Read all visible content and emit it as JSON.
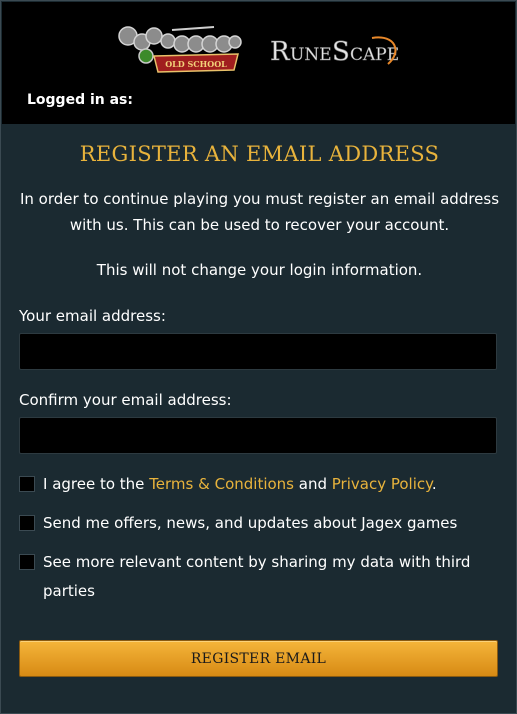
{
  "header": {
    "osrs_logo_text": "RuneScape Old School",
    "rs_logo_text": "RuneScape",
    "logged_in_label": "Logged in as:"
  },
  "form": {
    "title": "REGISTER AN EMAIL ADDRESS",
    "intro": "In order to continue playing you must register an email address with us. This can be used to recover your account.",
    "notice": "This will not change your login information.",
    "email_label": "Your email address:",
    "email_value": "",
    "confirm_label": "Confirm your email address:",
    "confirm_value": "",
    "agree_prefix": "I agree to the ",
    "terms_link": "Terms & Conditions",
    "agree_and": " and ",
    "privacy_link": "Privacy Policy",
    "agree_suffix": ".",
    "offers_label": "Send me offers, news, and updates about Jagex games",
    "share_label": "See more relevant content by sharing my data with third parties",
    "submit_label": "REGISTER EMAIL"
  },
  "colors": {
    "accent": "#e8b33c",
    "background": "#1b2a31",
    "header_bg": "#000000"
  }
}
